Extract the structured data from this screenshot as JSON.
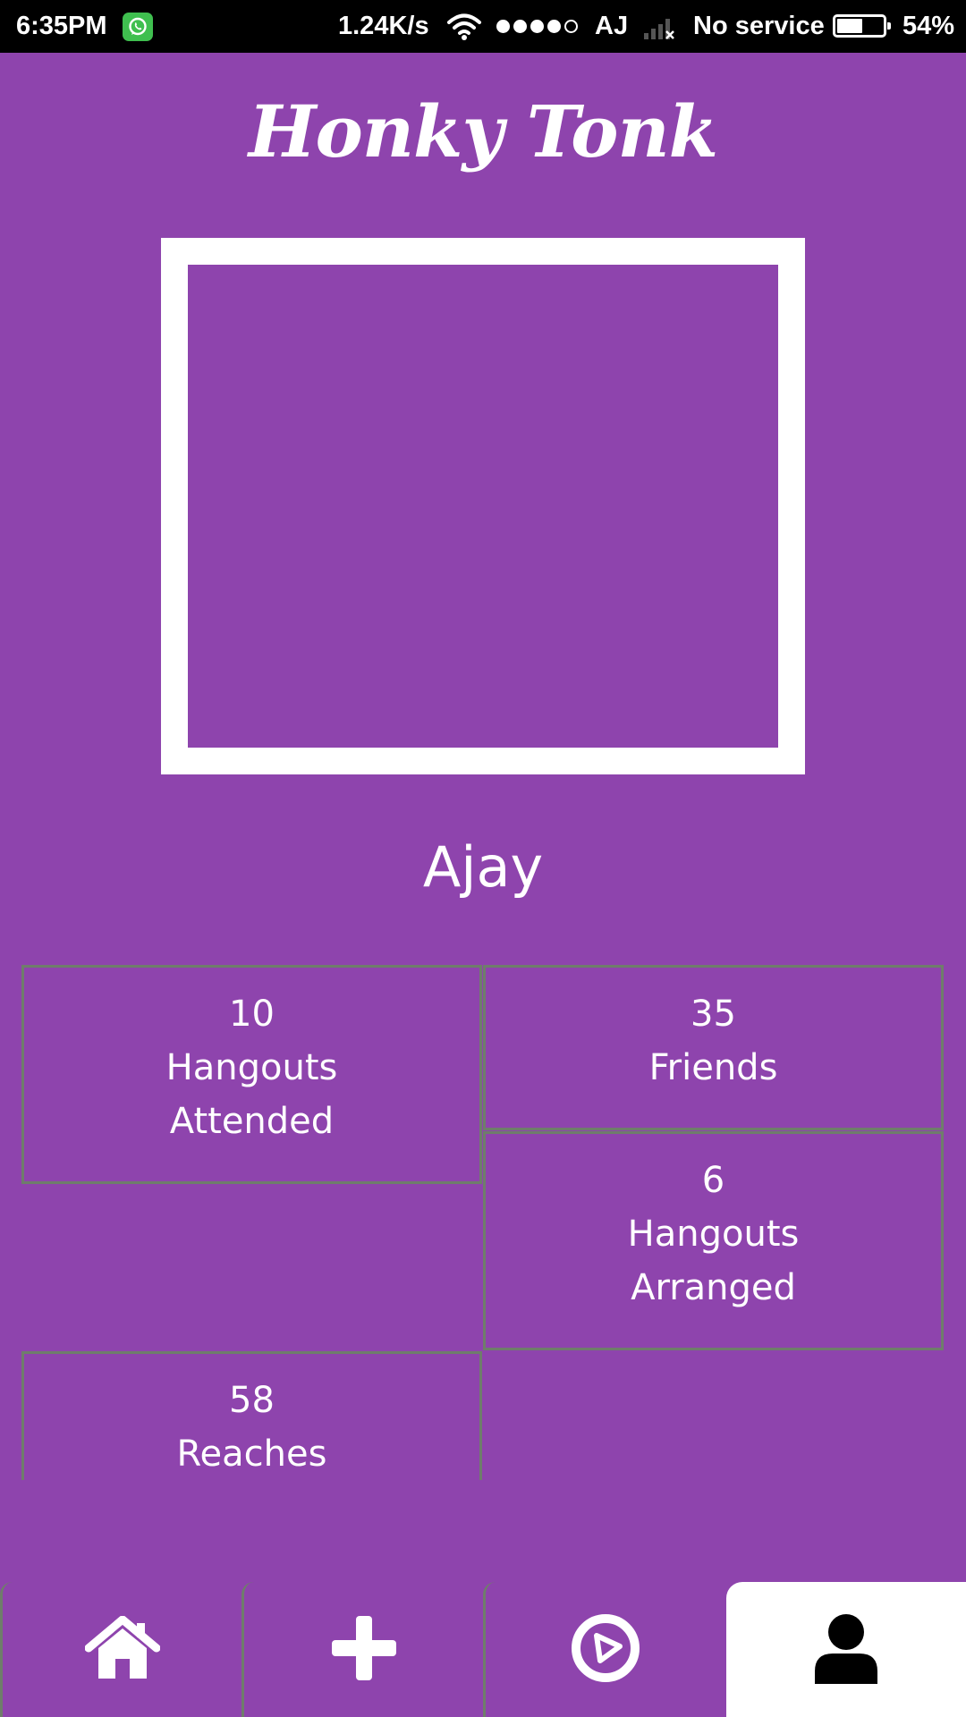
{
  "status_bar": {
    "time": "6:35PM",
    "network_speed": "1.24K/s",
    "carrier": "AJ",
    "service": "No service",
    "battery": "54%",
    "battery_level": 0.54,
    "signal_dots_filled": 4,
    "signal_dots_total": 5,
    "notification_icon": "whatsapp-icon",
    "wifi_icon": "wifi-icon",
    "no_signal_icon": "no-signal-icon"
  },
  "app": {
    "title": "Honky Tonk"
  },
  "profile": {
    "name": "Ajay"
  },
  "stats": {
    "hangouts_attended": {
      "value": "10",
      "label": "Hangouts\nAttended"
    },
    "friends": {
      "value": "35",
      "label": "Friends"
    },
    "hangouts_arranged": {
      "value": "6",
      "label": "Hangouts\nArranged"
    },
    "reaches": {
      "value": "58",
      "label": "Reaches"
    }
  },
  "nav": {
    "tabs": [
      {
        "icon": "home-icon",
        "active": false
      },
      {
        "icon": "plus-icon",
        "active": false
      },
      {
        "icon": "compass-icon",
        "active": false
      },
      {
        "icon": "user-icon",
        "active": true
      }
    ]
  },
  "colors": {
    "background": "#8e44ad",
    "foreground": "#ffffff",
    "border": "#6f7d6b",
    "status_bar": "#000000",
    "whatsapp": "#3fbf4f"
  }
}
